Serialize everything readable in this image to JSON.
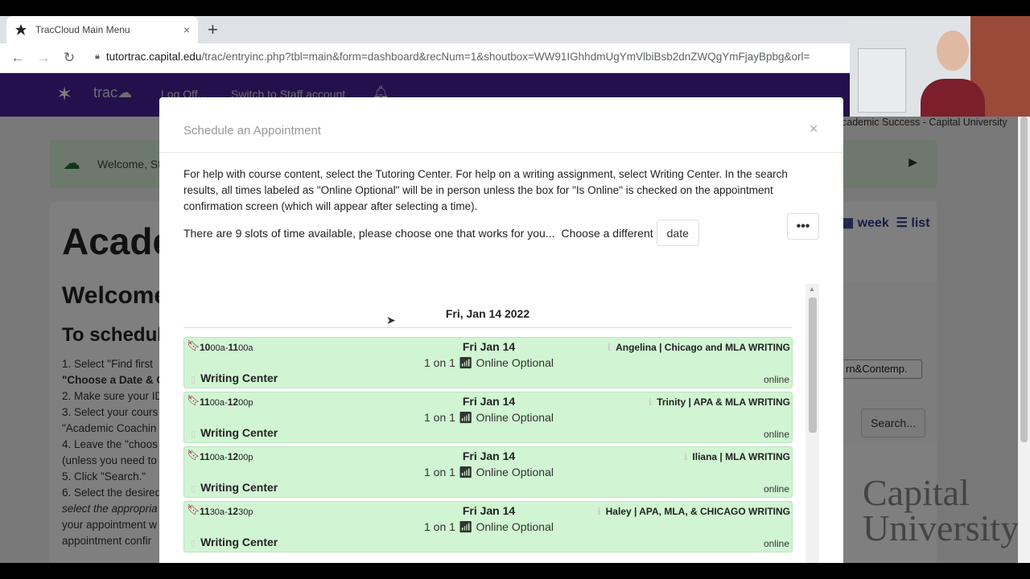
{
  "browser": {
    "tab_title": "TracCloud Main Menu",
    "tab_close": "×",
    "new_tab": "+",
    "url_host": "tutortrac.capital.edu",
    "url_path": "/trac/entryinc.php?tbl=main&form=dashboard&recNum=1&shoutbox=WW91IGhhdmUgYmVlbiBsb2dnZWQgYmFjayBpbg&orl="
  },
  "page": {
    "brand": "trac",
    "nav_links": [
      "Log Off...",
      "Switch to Staff account"
    ],
    "subnav": "cademic Success - Capital University",
    "welcome_text": "Welcome, St",
    "heading1": "Acade",
    "heading2": "Welcome",
    "heading3": "To schedule",
    "steps": [
      "1. Select \"Find first",
      "\"Choose a Date & C",
      "2. Make sure your ID",
      "3. Select your cours",
      "\"Academic Coachin",
      "4. Leave the \"choos",
      "(unless you need to",
      "5. Click \"Search.\"",
      "6. Select the desired",
      "select the appropria",
      "your appointment w",
      "appointment confir"
    ],
    "view_week": "week",
    "view_list": "list",
    "select_value": "rn&Contemp.",
    "search_button": "Search...",
    "univ_logo": "Capital University"
  },
  "modal": {
    "title": "Schedule an Appointment",
    "close": "×",
    "help_text": "For help with course content, select the Tutoring Center. For help on a writing assignment, select Writing Center. In the search results, all times labeled as \"Online Optional\" will be in person unless the box for \"Is Online\" is checked on the appointment confirmation screen (which will appear after selecting a time).",
    "slots_text": "There are 9 slots of time available, please choose one that works for you...",
    "choose_text": "Choose a different",
    "date_button": "date",
    "more_button": "•••",
    "day_heading": "Fri, Jan 14 2022",
    "slots": [
      {
        "start": "10",
        "start_min": "00a",
        "end": "11",
        "end_min": "00a",
        "date": "Fri Jan 14",
        "mode": "1 on 1",
        "format": "Online Optional",
        "tutor": "Angelina | Chicago and MLA WRITING",
        "center": "Writing Center",
        "status": "online"
      },
      {
        "start": "11",
        "start_min": "00a",
        "end": "12",
        "end_min": "00p",
        "date": "Fri Jan 14",
        "mode": "1 on 1",
        "format": "Online Optional",
        "tutor": "Trinity | APA & MLA WRITING",
        "center": "Writing Center",
        "status": "online"
      },
      {
        "start": "11",
        "start_min": "00a",
        "end": "12",
        "end_min": "00p",
        "date": "Fri Jan 14",
        "mode": "1 on 1",
        "format": "Online Optional",
        "tutor": "Iliana | MLA WRITING",
        "center": "Writing Center",
        "status": "online"
      },
      {
        "start": "11",
        "start_min": "30a",
        "end": "12",
        "end_min": "30p",
        "date": "Fri Jan 14",
        "mode": "1 on 1",
        "format": "Online Optional",
        "tutor": "Haley | APA, MLA, & CHICAGO WRITING",
        "center": "Writing Center",
        "status": "online"
      }
    ]
  },
  "colors": {
    "nav_purple": "#48209a",
    "slot_green": "#d1f5d3",
    "bookmark_red": "#a4123f"
  }
}
